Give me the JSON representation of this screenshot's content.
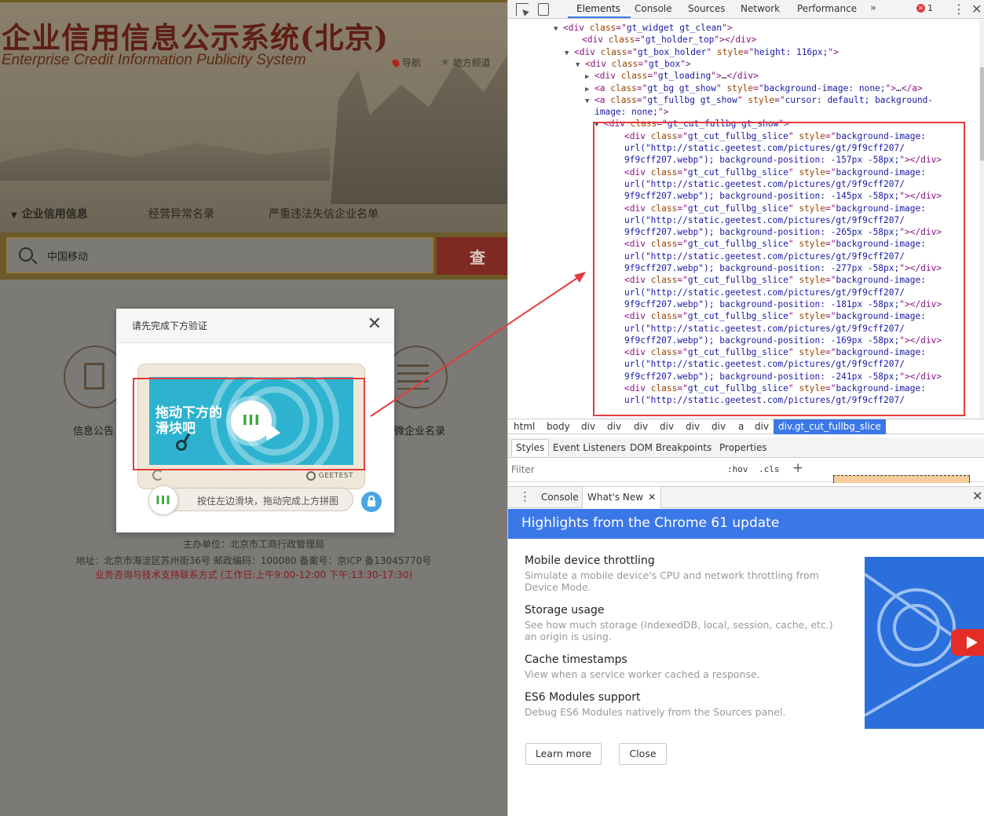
{
  "page": {
    "title": "企业信用信息公示系统(北京)",
    "subtitle": "Enterprise Credit Information Publicity System",
    "nav_link": "导航",
    "region_link": "地方频道",
    "tabs": [
      "企业信用信息",
      "经营异常名录",
      "严重违法失信企业名单"
    ],
    "search": {
      "value": "中国移动",
      "button": "查 询"
    },
    "circle_labels": [
      "信息公告",
      "微企业名录"
    ],
    "footer": {
      "line1": "主办单位：北京市工商行政管理局",
      "line2": "地址：北京市海淀区苏州街36号   邮政编码：100080 备案号：京ICP 备13045770号",
      "line3": "业务咨询与技术支持联系方式 (工作日:上午9:00-12:00 下午:13:30-17:30)"
    }
  },
  "captcha": {
    "title": "请先完成下方验证",
    "close": "✕",
    "image_text": "拖动下方的滑块吧",
    "knob_glyph": "III",
    "brand": "GEETEST",
    "slider_hint": "按住左边滑块，拖动完成上方拼图",
    "colors": {
      "accent": "#2db3cf",
      "handle": "#3ba83b",
      "lock": "#49a6e3"
    }
  },
  "devtools": {
    "tabs": [
      "Elements",
      "Console",
      "Sources",
      "Network",
      "Performance"
    ],
    "more": "»",
    "error_count": "1",
    "elements_lines": [
      {
        "indent": 70,
        "twisty": "▼",
        "parts": [
          [
            "tag",
            "<div "
          ],
          [
            "attr",
            "class"
          ],
          [
            "tag",
            "=\""
          ],
          [
            "val",
            "gt_widget gt_clean"
          ],
          [
            "tag",
            "\">"
          ]
        ]
      },
      {
        "indent": 94,
        "twisty": "",
        "parts": [
          [
            "tag",
            "<div "
          ],
          [
            "attr",
            "class"
          ],
          [
            "tag",
            "=\""
          ],
          [
            "val",
            "gt_holder_top"
          ],
          [
            "tag",
            "\"></div>"
          ]
        ]
      },
      {
        "indent": 84,
        "twisty": "▼",
        "parts": [
          [
            "tag",
            "<div "
          ],
          [
            "attr",
            "class"
          ],
          [
            "tag",
            "=\""
          ],
          [
            "val",
            "gt_box_holder"
          ],
          [
            "tag",
            "\" "
          ],
          [
            "attr",
            "style"
          ],
          [
            "tag",
            "=\""
          ],
          [
            "val",
            "height: 116px;"
          ],
          [
            "tag",
            "\">"
          ]
        ]
      },
      {
        "indent": 98,
        "twisty": "▼",
        "parts": [
          [
            "tag",
            "<div "
          ],
          [
            "attr",
            "class"
          ],
          [
            "tag",
            "=\""
          ],
          [
            "val",
            "gt_box"
          ],
          [
            "tag",
            "\">"
          ]
        ]
      },
      {
        "indent": 110,
        "twisty": "▶",
        "parts": [
          [
            "tag",
            "<div "
          ],
          [
            "attr",
            "class"
          ],
          [
            "tag",
            "=\""
          ],
          [
            "val",
            "gt_loading"
          ],
          [
            "tag",
            "\">"
          ],
          [
            "txt",
            "…"
          ],
          [
            "tag",
            "</div>"
          ]
        ]
      },
      {
        "indent": 110,
        "twisty": "▶",
        "parts": [
          [
            "tag",
            "<a "
          ],
          [
            "attr",
            "class"
          ],
          [
            "tag",
            "=\""
          ],
          [
            "val",
            "gt_bg gt_show"
          ],
          [
            "tag",
            "\" "
          ],
          [
            "attr",
            "style"
          ],
          [
            "tag",
            "=\""
          ],
          [
            "val",
            "background-image: none;"
          ],
          [
            "tag",
            "\">"
          ],
          [
            "txt",
            "…"
          ],
          [
            "tag",
            "</a>"
          ]
        ]
      },
      {
        "indent": 110,
        "twisty": "▼",
        "parts": [
          [
            "tag",
            "<a "
          ],
          [
            "attr",
            "class"
          ],
          [
            "tag",
            "=\""
          ],
          [
            "val",
            "gt_fullbg gt_show"
          ],
          [
            "tag",
            "\" "
          ],
          [
            "attr",
            "style"
          ],
          [
            "tag",
            "=\""
          ],
          [
            "val",
            "cursor: default; background-"
          ]
        ]
      },
      {
        "indent": 110,
        "twisty": "",
        "parts": [
          [
            "val",
            "image: none;"
          ],
          [
            "tag",
            "\">"
          ]
        ]
      },
      {
        "indent": 122,
        "twisty": "▼",
        "parts": [
          [
            "tag",
            "<div "
          ],
          [
            "attr",
            "class"
          ],
          [
            "tag",
            "=\""
          ],
          [
            "val",
            "gt_cut_fullbg gt_show"
          ],
          [
            "tag",
            "\">"
          ]
        ]
      },
      {
        "indent": 148,
        "twisty": "",
        "parts": [
          [
            "tag",
            "<div "
          ],
          [
            "attr",
            "class"
          ],
          [
            "tag",
            "=\""
          ],
          [
            "val",
            "gt_cut_fullbg_slice"
          ],
          [
            "tag",
            "\" "
          ],
          [
            "attr",
            "style"
          ],
          [
            "tag",
            "=\""
          ],
          [
            "val",
            "background-image:"
          ]
        ]
      },
      {
        "indent": 148,
        "twisty": "",
        "parts": [
          [
            "val",
            "url(\"http://static.geetest.com/pictures/gt/9f9cff207/"
          ]
        ]
      },
      {
        "indent": 148,
        "twisty": "",
        "parts": [
          [
            "val",
            "9f9cff207.webp\"); background-position: -157px -58px;"
          ],
          [
            "tag",
            "\"></div>"
          ]
        ]
      },
      {
        "indent": 148,
        "twisty": "",
        "parts": [
          [
            "tag",
            "<div "
          ],
          [
            "attr",
            "class"
          ],
          [
            "tag",
            "=\""
          ],
          [
            "val",
            "gt_cut_fullbg_slice"
          ],
          [
            "tag",
            "\" "
          ],
          [
            "attr",
            "style"
          ],
          [
            "tag",
            "=\""
          ],
          [
            "val",
            "background-image:"
          ]
        ]
      },
      {
        "indent": 148,
        "twisty": "",
        "parts": [
          [
            "val",
            "url(\"http://static.geetest.com/pictures/gt/9f9cff207/"
          ]
        ]
      },
      {
        "indent": 148,
        "twisty": "",
        "parts": [
          [
            "val",
            "9f9cff207.webp\"); background-position: -145px -58px;"
          ],
          [
            "tag",
            "\"></div>"
          ]
        ]
      },
      {
        "indent": 148,
        "twisty": "",
        "parts": [
          [
            "tag",
            "<div "
          ],
          [
            "attr",
            "class"
          ],
          [
            "tag",
            "=\""
          ],
          [
            "val",
            "gt_cut_fullbg_slice"
          ],
          [
            "tag",
            "\" "
          ],
          [
            "attr",
            "style"
          ],
          [
            "tag",
            "=\""
          ],
          [
            "val",
            "background-image:"
          ]
        ]
      },
      {
        "indent": 148,
        "twisty": "",
        "parts": [
          [
            "val",
            "url(\"http://static.geetest.com/pictures/gt/9f9cff207/"
          ]
        ]
      },
      {
        "indent": 148,
        "twisty": "",
        "parts": [
          [
            "val",
            "9f9cff207.webp\"); background-position: -265px -58px;"
          ],
          [
            "tag",
            "\"></div>"
          ]
        ]
      },
      {
        "indent": 148,
        "twisty": "",
        "parts": [
          [
            "tag",
            "<div "
          ],
          [
            "attr",
            "class"
          ],
          [
            "tag",
            "=\""
          ],
          [
            "val",
            "gt_cut_fullbg_slice"
          ],
          [
            "tag",
            "\" "
          ],
          [
            "attr",
            "style"
          ],
          [
            "tag",
            "=\""
          ],
          [
            "val",
            "background-image:"
          ]
        ]
      },
      {
        "indent": 148,
        "twisty": "",
        "parts": [
          [
            "val",
            "url(\"http://static.geetest.com/pictures/gt/9f9cff207/"
          ]
        ]
      },
      {
        "indent": 148,
        "twisty": "",
        "parts": [
          [
            "val",
            "9f9cff207.webp\"); background-position: -277px -58px;"
          ],
          [
            "tag",
            "\"></div>"
          ]
        ]
      },
      {
        "indent": 148,
        "twisty": "",
        "parts": [
          [
            "tag",
            "<div "
          ],
          [
            "attr",
            "class"
          ],
          [
            "tag",
            "=\""
          ],
          [
            "val",
            "gt_cut_fullbg_slice"
          ],
          [
            "tag",
            "\" "
          ],
          [
            "attr",
            "style"
          ],
          [
            "tag",
            "=\""
          ],
          [
            "val",
            "background-image:"
          ]
        ]
      },
      {
        "indent": 148,
        "twisty": "",
        "parts": [
          [
            "val",
            "url(\"http://static.geetest.com/pictures/gt/9f9cff207/"
          ]
        ]
      },
      {
        "indent": 148,
        "twisty": "",
        "parts": [
          [
            "val",
            "9f9cff207.webp\"); background-position: -181px -58px;"
          ],
          [
            "tag",
            "\"></div>"
          ]
        ]
      },
      {
        "indent": 148,
        "twisty": "",
        "parts": [
          [
            "tag",
            "<div "
          ],
          [
            "attr",
            "class"
          ],
          [
            "tag",
            "=\""
          ],
          [
            "val",
            "gt_cut_fullbg_slice"
          ],
          [
            "tag",
            "\" "
          ],
          [
            "attr",
            "style"
          ],
          [
            "tag",
            "=\""
          ],
          [
            "val",
            "background-image:"
          ]
        ]
      },
      {
        "indent": 148,
        "twisty": "",
        "parts": [
          [
            "val",
            "url(\"http://static.geetest.com/pictures/gt/9f9cff207/"
          ]
        ]
      },
      {
        "indent": 148,
        "twisty": "",
        "parts": [
          [
            "val",
            "9f9cff207.webp\"); background-position: -169px -58px;"
          ],
          [
            "tag",
            "\"></div>"
          ]
        ]
      },
      {
        "indent": 148,
        "twisty": "",
        "parts": [
          [
            "tag",
            "<div "
          ],
          [
            "attr",
            "class"
          ],
          [
            "tag",
            "=\""
          ],
          [
            "val",
            "gt_cut_fullbg_slice"
          ],
          [
            "tag",
            "\" "
          ],
          [
            "attr",
            "style"
          ],
          [
            "tag",
            "=\""
          ],
          [
            "val",
            "background-image:"
          ]
        ]
      },
      {
        "indent": 148,
        "twisty": "",
        "parts": [
          [
            "val",
            "url(\"http://static.geetest.com/pictures/gt/9f9cff207/"
          ]
        ]
      },
      {
        "indent": 148,
        "twisty": "",
        "parts": [
          [
            "val",
            "9f9cff207.webp\"); background-position: -241px -58px;"
          ],
          [
            "tag",
            "\"></div>"
          ]
        ]
      },
      {
        "indent": 148,
        "twisty": "",
        "parts": [
          [
            "tag",
            "<div "
          ],
          [
            "attr",
            "class"
          ],
          [
            "tag",
            "=\""
          ],
          [
            "val",
            "gt_cut_fullbg_slice"
          ],
          [
            "tag",
            "\" "
          ],
          [
            "attr",
            "style"
          ],
          [
            "tag",
            "=\""
          ],
          [
            "val",
            "background-image:"
          ]
        ]
      },
      {
        "indent": 148,
        "twisty": "",
        "parts": [
          [
            "val",
            "url(\"http://static.geetest.com/pictures/gt/9f9cff207/"
          ]
        ]
      }
    ],
    "breadcrumbs": [
      "html",
      "body",
      "div",
      "div",
      "div",
      "div",
      "div",
      "div",
      "a",
      "div",
      "div.gt_cut_fullbg_slice"
    ],
    "styles_tabs": [
      "Styles",
      "Event Listeners",
      "DOM Breakpoints",
      "Properties"
    ],
    "filter_placeholder": "Filter",
    "filter_hov": ":hov",
    "filter_cls": ".cls",
    "plus": "+",
    "drawer_tabs": [
      "Console",
      "What's New"
    ],
    "drawer_tab_close": "✕",
    "drawer_close": "✕",
    "whatsnew_title": "Highlights from the Chrome 61 update",
    "features": [
      {
        "title": "Mobile device throttling",
        "desc": "Simulate a mobile device's CPU and network throttling from Device Mode."
      },
      {
        "title": "Storage usage",
        "desc": "See how much storage (IndexedDB, local, session, cache, etc.) an origin is using."
      },
      {
        "title": "Cache timestamps",
        "desc": "View when a service worker cached a response."
      },
      {
        "title": "ES6 Modules support",
        "desc": "Debug ES6 Modules natively from the Sources panel."
      }
    ],
    "learn_more": "Learn more",
    "close_btn": "Close",
    "colors": {
      "selection": "#3b78e7",
      "tag": "#881280",
      "attr": "#994500",
      "value": "#1a1aa6",
      "highlight": "#e53b3b"
    }
  }
}
